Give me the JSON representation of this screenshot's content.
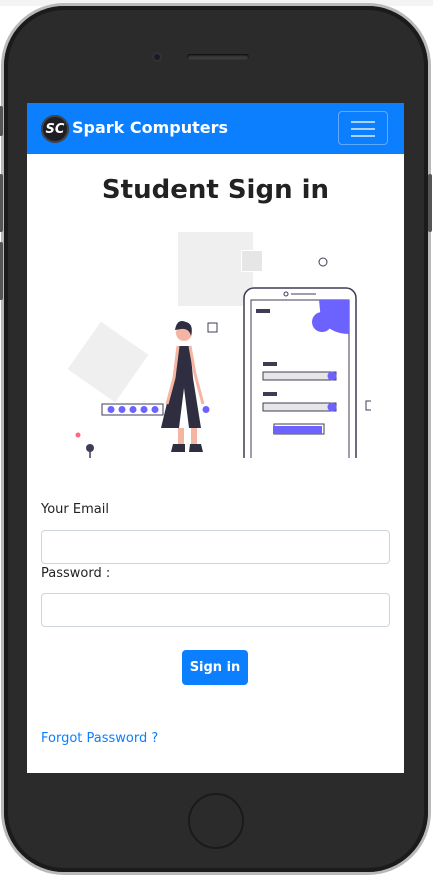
{
  "navbar": {
    "logo_text": "SC",
    "brand": "Spark Computers",
    "toggler_icon": "hamburger-icon",
    "accent": "#0c7fff"
  },
  "page": {
    "title": "Student Sign in"
  },
  "form": {
    "email_label": "Your Email",
    "email_value": "",
    "email_placeholder": "",
    "password_label": "Password :",
    "password_value": "",
    "password_placeholder": "",
    "submit_label": "Sign in",
    "forgot_link": "Forgot Password ?"
  },
  "illustration": {
    "icon": "login-illustration",
    "accent": "#6c63ff"
  }
}
